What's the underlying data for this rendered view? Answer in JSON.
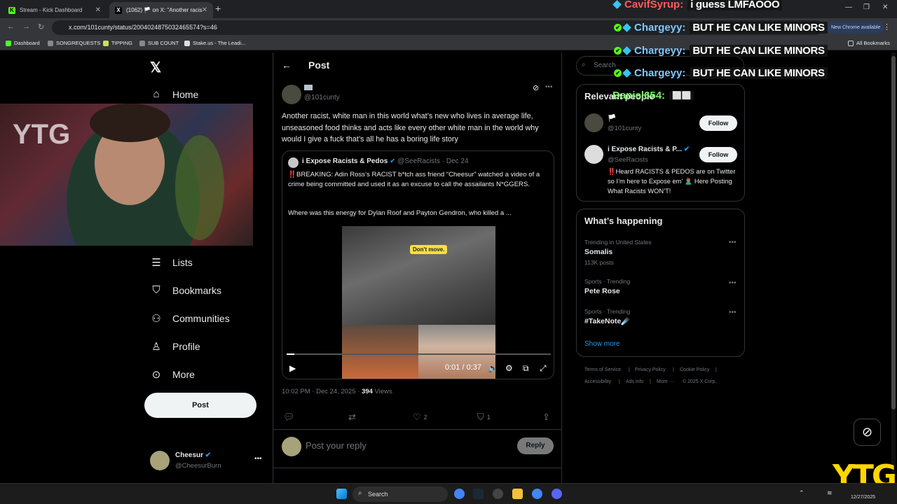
{
  "browser": {
    "tabs": [
      {
        "label": "Stream - Kick Dashboard",
        "favicon": "K"
      },
      {
        "label": "(1062) 🏳️ on X: \"Another racis",
        "favicon": "X"
      }
    ],
    "new_tab": "+",
    "url": "x.com/101cunty/status/2004024875032465574?s=46",
    "update_label": "New Chrome available",
    "bookmarks": [
      "Dashboard",
      "SONGREQUESTS",
      "TIPPING",
      "SUB COUNT",
      "Stake.us - The Leadi...",
      "All Bookmarks"
    ]
  },
  "sidebar": {
    "items": [
      {
        "label": "Home",
        "icon": "home-icon"
      },
      {
        "label": "Lists",
        "icon": "lists-icon"
      },
      {
        "label": "Bookmarks",
        "icon": "bookmark-icon"
      },
      {
        "label": "Communities",
        "icon": "communities-icon"
      },
      {
        "label": "Profile",
        "icon": "profile-icon"
      },
      {
        "label": "More",
        "icon": "more-circle-icon"
      }
    ],
    "post_button": "Post",
    "account": {
      "name": "Cheesur",
      "handle": "@CheesurBurn"
    }
  },
  "post": {
    "header": "Post",
    "author_handle": "@101cunty",
    "text": "Another racist, white man in this world what’s new who lives in average life, unseasoned food thinks and acts like every other white man in the world why would I give a fuck that’s all he has a boring life story",
    "quote": {
      "author": "i Expose Racists & Pedos",
      "handle": "@SeeRacists",
      "date": "Dec 24",
      "text": "‼️BREAKING: Adin Ross’s RACIST b*tch ass friend “Cheesur” watched a video of a crime being committed and used it as an excuse to call the assailants N*GGERS.",
      "text2": "Where was this energy for Dylan Roof and Payton Gendron, who killed a ...",
      "video_caption": "Don't move.",
      "video_time": "0:01 / 0:37",
      "video_progress": 0.03
    },
    "timestamp": "10:02 PM · Dec 24, 2025 · ",
    "views": "394",
    "views_label": " Views",
    "likes": "2",
    "bookmarks": "1",
    "reply_placeholder": "Post your reply",
    "reply_button": "Reply"
  },
  "right": {
    "search_placeholder": "Search",
    "relevant_title": "Relevant people",
    "people": [
      {
        "name": "🏳️",
        "handle": "@101cunty",
        "follow": "Follow"
      },
      {
        "name": "i Expose Racists & P...",
        "handle": "@SeeRacists",
        "follow": "Follow",
        "bio": "‼️Heard RACISTS & PEDOS are on Twitter so I’m here to Expose em’ 🙎🏽‍♂️ Here Posting What Racists WON’T!"
      }
    ],
    "happening_title": "What’s happening",
    "trends": [
      {
        "meta": "Trending in United States",
        "name": "Somalis",
        "count": "113K posts"
      },
      {
        "meta": "Sports · Trending",
        "name": "Pete Rose",
        "count": ""
      },
      {
        "meta": "Sports · Trending",
        "name": "#TakeNote☄️",
        "count": ""
      }
    ],
    "show_more": "Show more",
    "footer": [
      "Terms of Service",
      "|",
      "Privacy Policy",
      "|",
      "Cookie Policy",
      "|",
      "Accessibility",
      "|",
      "Ads info",
      "|",
      "More ···",
      "© 2025 X Corp."
    ]
  },
  "chat": [
    {
      "user": "CavifSyrup:",
      "msg": "i guess LMFAOOO"
    },
    {
      "user": "Chargeyy:",
      "msg": "BUT HE CAN LIKE MINORS"
    },
    {
      "user": "Chargeyy:",
      "msg": "BUT HE CAN LIKE MINORS"
    },
    {
      "user": "Chargeyy:",
      "msg": "BUT HE CAN LIKE MINORS"
    },
    {
      "user": "Daniel654:",
      "msg": "⬜⬜"
    }
  ],
  "taskbar": {
    "search": "Search",
    "date": "12/27/2025"
  },
  "overlay": {
    "watermark": "YTG",
    "cam_text": "YTG"
  },
  "colors": {
    "accent": "#1d9bf0",
    "kick_green": "#53fc18",
    "ytg_yellow": "#ffd600"
  }
}
